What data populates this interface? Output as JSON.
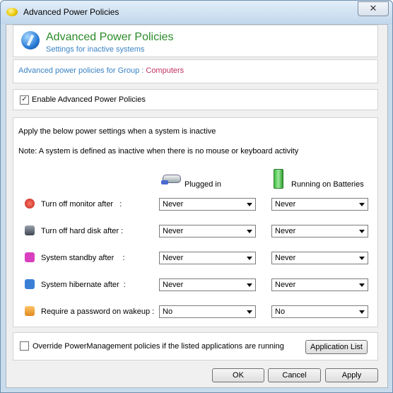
{
  "window": {
    "title": "Advanced Power Policies",
    "close_glyph": "✕"
  },
  "header": {
    "title": "Advanced Power Policies",
    "subtitle": "Settings for inactive systems"
  },
  "group": {
    "label": "Advanced power policies for Group : ",
    "value": "Computers"
  },
  "enable": {
    "label": "Enable Advanced Power Policies",
    "checked": true
  },
  "settings": {
    "intro": "Apply the below power settings when a system is inactive",
    "note": "Note: A system is defined as inactive when there is no mouse or keyboard activity",
    "col_plugged": "Plugged in",
    "col_battery": "Running on Batteries",
    "rows": [
      {
        "label": "Turn off monitor after   :",
        "icon": "power-icon",
        "plugged": "Never",
        "battery": "Never"
      },
      {
        "label": "Turn off hard disk after :",
        "icon": "hard-disk-icon",
        "plugged": "Never",
        "battery": "Never"
      },
      {
        "label": "System standby after    :",
        "icon": "standby-icon",
        "plugged": "Never",
        "battery": "Never"
      },
      {
        "label": "System hibernate after  :",
        "icon": "hibernate-icon",
        "plugged": "Never",
        "battery": "Never"
      },
      {
        "label": "Require a password on wakeup :",
        "icon": "lock-icon",
        "plugged": "No",
        "battery": "No"
      }
    ]
  },
  "override": {
    "label": "Override PowerManagement policies if the listed applications are running",
    "checked": false,
    "button": "Application List"
  },
  "buttons": {
    "ok": "OK",
    "cancel": "Cancel",
    "apply": "Apply"
  },
  "colors": {
    "title_green": "#2b8a2b",
    "link_blue": "#3a82c4",
    "group_red": "#c03060"
  }
}
